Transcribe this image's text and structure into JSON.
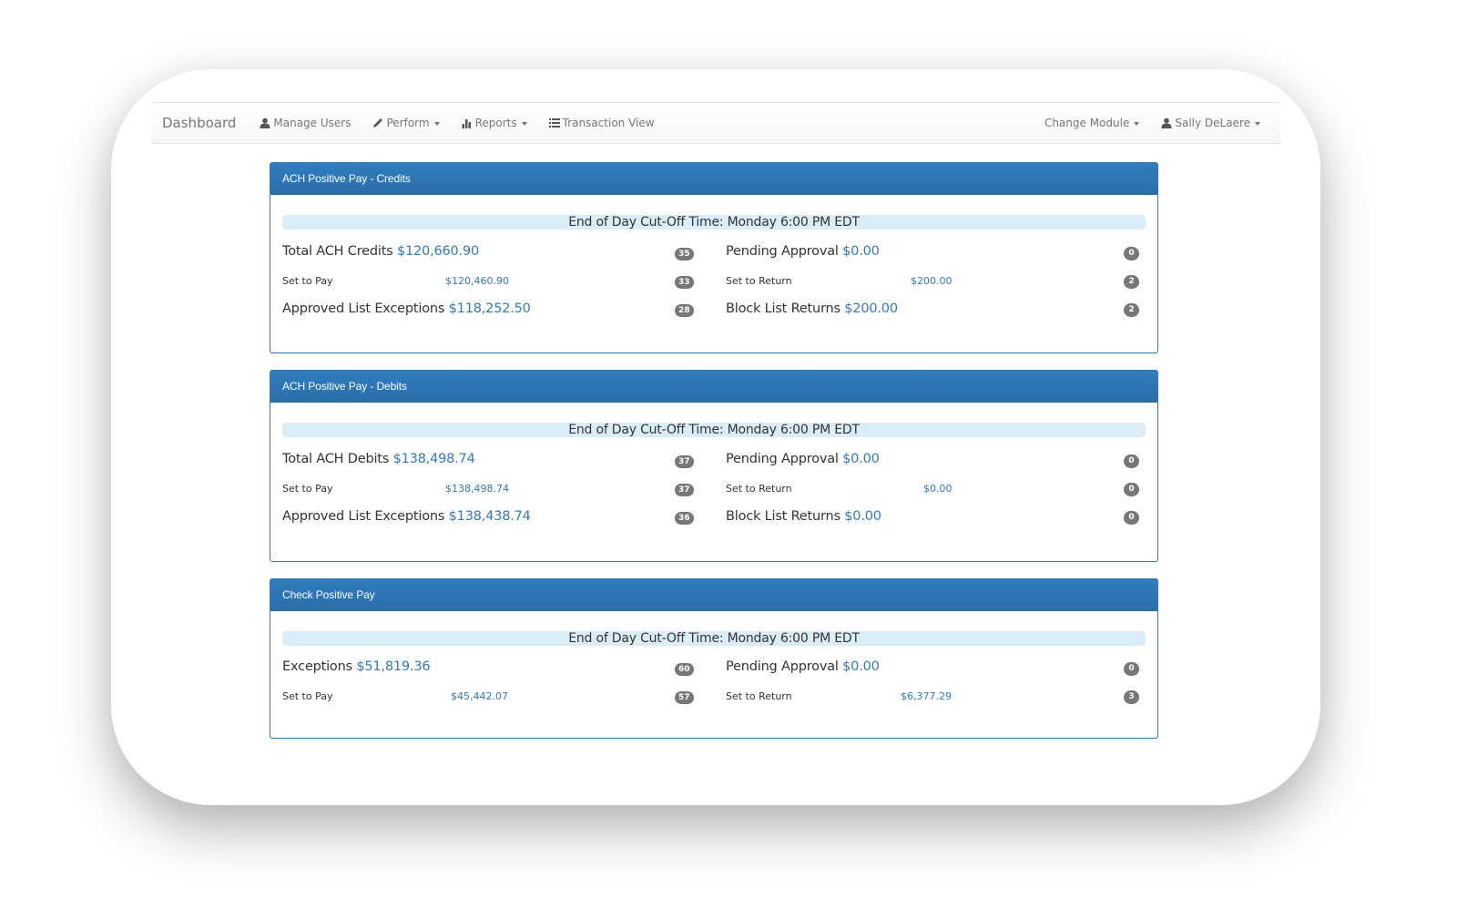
{
  "navbar": {
    "brand": "Dashboard",
    "items": [
      {
        "label": "Manage Users",
        "icon": "user-icon",
        "dropdown": false
      },
      {
        "label": "Perform",
        "icon": "pencil-icon",
        "dropdown": true
      },
      {
        "label": "Reports",
        "icon": "bar-chart-icon",
        "dropdown": true
      },
      {
        "label": "Transaction View",
        "icon": "list-icon",
        "dropdown": false
      }
    ],
    "right": [
      {
        "label": "Change Module",
        "dropdown": true
      },
      {
        "label": "Sally DeLaere",
        "icon": "user-icon",
        "dropdown": true
      }
    ]
  },
  "colors": {
    "panel_header": "#2e75b5",
    "amount_blue": "#337ab7",
    "cutoff_bg": "#d9edf7",
    "badge": "#777777"
  },
  "panels": [
    {
      "title": "ACH Positive Pay - Credits",
      "cutoff": "End of Day Cut-Off Time: Monday 6:00 PM EDT",
      "left": [
        {
          "label": "Total ACH Credits",
          "amount": "$120,660.90",
          "count": "35",
          "size": "big"
        },
        {
          "label": "Set to Pay",
          "amount": "$120,460.90",
          "count": "33",
          "size": "small"
        },
        {
          "label": "Approved List Exceptions",
          "amount": "$118,252.50",
          "count": "28",
          "size": "big"
        }
      ],
      "right": [
        {
          "label": "Pending Approval",
          "amount": "$0.00",
          "count": "0",
          "size": "big"
        },
        {
          "label": "Set to Return",
          "amount": "$200.00",
          "count": "2",
          "size": "small"
        },
        {
          "label": "Block List Returns",
          "amount": "$200.00",
          "count": "2",
          "size": "big"
        }
      ]
    },
    {
      "title": "ACH Positive Pay - Debits",
      "cutoff": "End of Day Cut-Off Time: Monday 6:00 PM EDT",
      "left": [
        {
          "label": "Total ACH Debits",
          "amount": "$138,498.74",
          "count": "37",
          "size": "big"
        },
        {
          "label": "Set to Pay",
          "amount": "$138,498.74",
          "count": "37",
          "size": "small"
        },
        {
          "label": "Approved List Exceptions",
          "amount": "$138,438.74",
          "count": "36",
          "size": "big"
        }
      ],
      "right": [
        {
          "label": "Pending Approval",
          "amount": "$0.00",
          "count": "0",
          "size": "big"
        },
        {
          "label": "Set to Return",
          "amount": "$0.00",
          "count": "0",
          "size": "small"
        },
        {
          "label": "Block List Returns",
          "amount": "$0.00",
          "count": "0",
          "size": "big"
        }
      ]
    },
    {
      "title": "Check Positive Pay",
      "cutoff": "End of Day Cut-Off Time: Monday 6:00 PM EDT",
      "left": [
        {
          "label": "Exceptions",
          "amount": "$51,819.36",
          "count": "60",
          "size": "big"
        },
        {
          "label": "Set to Pay",
          "amount": "$45,442.07",
          "count": "57",
          "size": "small"
        }
      ],
      "right": [
        {
          "label": "Pending Approval",
          "amount": "$0.00",
          "count": "0",
          "size": "big"
        },
        {
          "label": "Set to Return",
          "amount": "$6,377.29",
          "count": "3",
          "size": "small"
        }
      ]
    }
  ]
}
